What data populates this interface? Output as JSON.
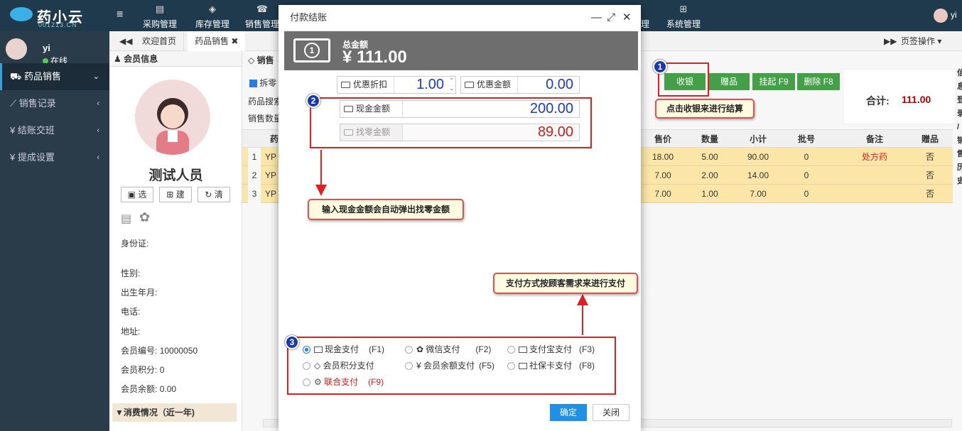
{
  "topbar": {
    "logo": {
      "name": "药小云",
      "site": "001213.CN"
    },
    "nav": [
      {
        "label": "采购管理",
        "icon": "cart-icon"
      },
      {
        "label": "库存管理",
        "icon": "box-icon"
      },
      {
        "label": "销售管理",
        "icon": "phone-icon"
      },
      {
        "label": "理",
        "icon": "chart-icon"
      },
      {
        "label": "系统管理",
        "icon": "windows-icon"
      }
    ],
    "user": "yi"
  },
  "sidebar": {
    "user_name": "yi",
    "status": "在线",
    "items": [
      {
        "label": "药品销售",
        "icon": "cart-icon"
      },
      {
        "label": "销售记录",
        "icon": "line-chart-icon"
      },
      {
        "label": "结账交班",
        "icon": "yen-icon"
      },
      {
        "label": "提成设置",
        "icon": "yen-icon"
      }
    ]
  },
  "tabs": {
    "home": "欢迎首页",
    "sales": "药品销售",
    "close": "✖",
    "page_ops": "页签操作"
  },
  "member": {
    "header": "会员信息",
    "name": "测试人员",
    "buttons": {
      "select": "选",
      "create": "建",
      "clear": "清"
    },
    "fields": [
      {
        "label": "身份证:",
        "value": ""
      },
      {
        "label": "性别:",
        "value": ""
      },
      {
        "label": "出生年月:",
        "value": ""
      },
      {
        "label": "电话:",
        "value": ""
      },
      {
        "label": "地址:",
        "value": ""
      },
      {
        "label": "会员编号:",
        "value": "10000050"
      },
      {
        "label": "会员积分:",
        "value": "0"
      },
      {
        "label": "会员余额:",
        "value": "0.00"
      }
    ],
    "consume": "▼消费情况（近一年)"
  },
  "sales": {
    "header": "销售",
    "split_label": "拆零",
    "search_label": "药品搜索",
    "qty_label": "销售数量",
    "buttons": {
      "checkout": "收银",
      "gift": "赠品",
      "hold": "挂起 F9",
      "delete": "删除 F8"
    },
    "total_label": "合计:",
    "total_value": "111.00",
    "columns": [
      "药",
      "售价",
      "数量",
      "小计",
      "批号",
      "备注",
      "赠品"
    ],
    "rows": [
      {
        "no": "1",
        "code": "YP",
        "price": "18.00",
        "qty": "5.00",
        "subtotal": "90.00",
        "batch": "0",
        "note": "处方药",
        "gift": "否"
      },
      {
        "no": "2",
        "code": "YP",
        "price": "7.00",
        "qty": "2.00",
        "subtotal": "14.00",
        "batch": "0",
        "note": "",
        "gift": "否"
      },
      {
        "no": "3",
        "code": "YP",
        "price": "7.00",
        "qty": "1.00",
        "subtotal": "7.00",
        "batch": "0",
        "note": "",
        "gift": "否"
      }
    ],
    "right_side_text": [
      "信",
      "息",
      "登",
      "录",
      "/",
      "销",
      "售",
      "历",
      "史"
    ]
  },
  "modal": {
    "title": "付款结账",
    "total_label": "总金额",
    "total_amount": "¥ 111.00",
    "bill_glyph": "1",
    "discount_rate_label": "优惠折扣",
    "discount_rate_value": "1.00",
    "discount_amount_label": "优惠金额",
    "discount_amount_value": "0.00",
    "cash_label": "现金金额",
    "cash_value": "200.00",
    "change_label": "找零金额",
    "change_value": "89.00",
    "payments": [
      {
        "label": "现金支付",
        "key": "(F1)",
        "icon": "cash-icon",
        "selected": true
      },
      {
        "label": "微信支付",
        "key": "(F2)",
        "icon": "wechat-icon",
        "selected": false
      },
      {
        "label": "支付宝支付",
        "key": "(F3)",
        "icon": "alipay-card-icon",
        "selected": false
      },
      {
        "label": "会员积分支付",
        "key": "",
        "icon": "diamond-icon",
        "selected": false
      },
      {
        "label": "会员余额支付",
        "key": "(F5)",
        "icon": "yen-icon",
        "selected": false
      },
      {
        "label": "社保卡支付",
        "key": "(F8)",
        "icon": "id-card-icon",
        "selected": false
      },
      {
        "label": "联合支付",
        "key": "(F9)",
        "icon": "combo-icon",
        "selected": false
      }
    ],
    "ok": "确定",
    "close": "关闭"
  },
  "annotations": {
    "badge1": "1",
    "badge2": "2",
    "badge3": "3",
    "callout1": "点击收银来进行结算",
    "callout2": "输入现金金额会自动弹出找零金额",
    "callout3": "支付方式按顾客需求来进行支付"
  },
  "colors": {
    "topbar": "#1f3a4d",
    "sidebar": "#2a3b4a",
    "row_highlight": "#fbe6a8",
    "green_button": "#43a047",
    "ok_button": "#1e90e6",
    "annotation_red": "#e02020",
    "badge_blue": "#1a3aa8"
  }
}
